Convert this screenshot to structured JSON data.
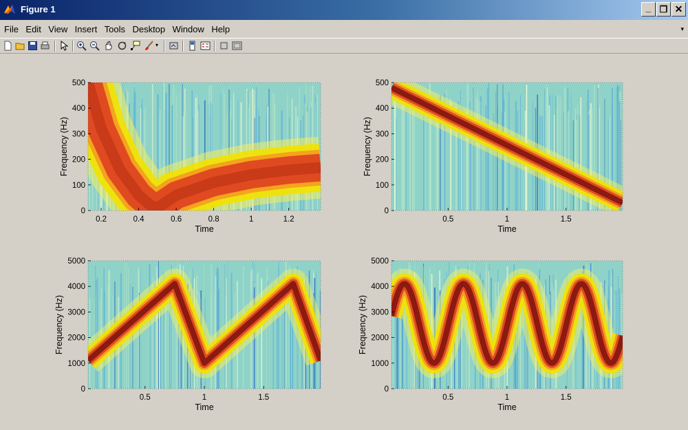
{
  "window": {
    "title": "Figure 1",
    "minimize_label": "_",
    "restore_label": "❐",
    "close_label": "✕"
  },
  "menubar": {
    "items": [
      "File",
      "Edit",
      "View",
      "Insert",
      "Tools",
      "Desktop",
      "Window",
      "Help"
    ]
  },
  "toolbar": {
    "icons": [
      "new-figure-icon",
      "open-file-icon",
      "save-icon",
      "print-icon",
      "edit-plot-icon",
      "zoom-in-icon",
      "zoom-out-icon",
      "pan-icon",
      "rotate-3d-icon",
      "data-cursor-icon",
      "brush-icon",
      "link-plot-icon",
      "insert-colorbar-icon",
      "insert-legend-icon",
      "hide-plot-tools-icon",
      "show-plot-tools-icon"
    ]
  },
  "colors": {
    "background": "#d4d0c8",
    "spectrogram_ridge": "#8b1a10",
    "spectrogram_halo": "#f2e200",
    "spectrogram_bg": "#8fd3c8"
  },
  "chart_data": [
    {
      "type": "heatmap",
      "xlabel": "Time",
      "ylabel": "Frequency (Hz)",
      "xlim": [
        0.13,
        1.37
      ],
      "ylim": [
        0,
        500
      ],
      "xticks": [
        "0.2",
        "0.4",
        "0.6",
        "0.8",
        "1",
        "1.2"
      ],
      "xtick_values": [
        0.2,
        0.4,
        0.6,
        0.8,
        1.0,
        1.2
      ],
      "yticks": [
        "0",
        "100",
        "200",
        "300",
        "400",
        "500"
      ],
      "ytick_values": [
        0,
        100,
        200,
        300,
        400,
        500
      ],
      "ridge": {
        "x": [
          0.13,
          0.2,
          0.3,
          0.4,
          0.48,
          0.52,
          0.6,
          0.8,
          1.0,
          1.2,
          1.37
        ],
        "y": [
          500,
          320,
          160,
          60,
          10,
          20,
          60,
          110,
          140,
          158,
          168
        ]
      },
      "ridge_wide": true,
      "grid": false
    },
    {
      "type": "heatmap",
      "xlabel": "Time",
      "ylabel": "Frequency (Hz)",
      "xlim": [
        0.02,
        1.98
      ],
      "ylim": [
        0,
        500
      ],
      "xticks": [
        "0.5",
        "1",
        "1.5"
      ],
      "xtick_values": [
        0.5,
        1.0,
        1.5
      ],
      "yticks": [
        "0",
        "100",
        "200",
        "300",
        "400",
        "500"
      ],
      "ytick_values": [
        0,
        100,
        200,
        300,
        400,
        500
      ],
      "ridge": {
        "x": [
          0.02,
          1.98
        ],
        "y": [
          480,
          30
        ]
      },
      "ridge_wide": false,
      "grid": false
    },
    {
      "type": "heatmap",
      "xlabel": "Time",
      "ylabel": "Frequency (Hz)",
      "xlim": [
        0.02,
        1.98
      ],
      "ylim": [
        0,
        5000
      ],
      "xticks": [
        "0.5",
        "1",
        "1.5"
      ],
      "xtick_values": [
        0.5,
        1.0,
        1.5
      ],
      "yticks": [
        "0",
        "1000",
        "2000",
        "3000",
        "4000",
        "5000"
      ],
      "ytick_values": [
        0,
        1000,
        2000,
        3000,
        4000,
        5000
      ],
      "ridge": {
        "x": [
          0.02,
          0.75,
          1.0,
          1.75,
          1.98
        ],
        "y": [
          1100,
          4100,
          1000,
          4100,
          1100
        ]
      },
      "ridge_wide": false,
      "grid": false
    },
    {
      "type": "heatmap",
      "xlabel": "Time",
      "ylabel": "Frequency (Hz)",
      "xlim": [
        0.02,
        1.98
      ],
      "ylim": [
        0,
        5000
      ],
      "xticks": [
        "0.5",
        "1",
        "1.5"
      ],
      "xtick_values": [
        0.5,
        1.0,
        1.5
      ],
      "yticks": [
        "0",
        "1000",
        "2000",
        "3000",
        "4000",
        "5000"
      ],
      "ytick_values": [
        0,
        1000,
        2000,
        3000,
        4000,
        5000
      ],
      "ridge_sine": {
        "center": 2550,
        "amplitude": 1550,
        "period": 0.5,
        "phase_time": 0.13
      },
      "ridge_wide": false,
      "grid": false
    }
  ]
}
